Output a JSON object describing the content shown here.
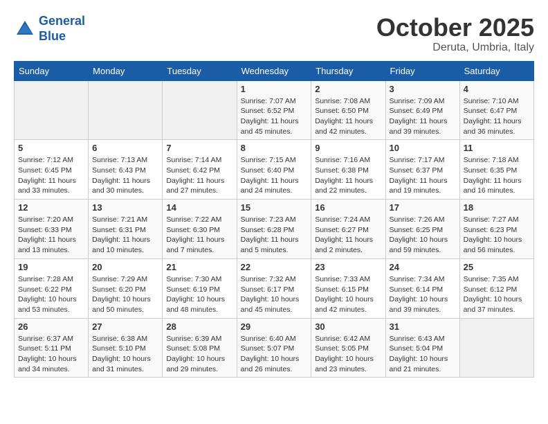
{
  "header": {
    "logo_line1": "General",
    "logo_line2": "Blue",
    "month": "October 2025",
    "location": "Deruta, Umbria, Italy"
  },
  "weekdays": [
    "Sunday",
    "Monday",
    "Tuesday",
    "Wednesday",
    "Thursday",
    "Friday",
    "Saturday"
  ],
  "weeks": [
    [
      {
        "day": "",
        "info": ""
      },
      {
        "day": "",
        "info": ""
      },
      {
        "day": "",
        "info": ""
      },
      {
        "day": "1",
        "info": "Sunrise: 7:07 AM\nSunset: 6:52 PM\nDaylight: 11 hours\nand 45 minutes."
      },
      {
        "day": "2",
        "info": "Sunrise: 7:08 AM\nSunset: 6:50 PM\nDaylight: 11 hours\nand 42 minutes."
      },
      {
        "day": "3",
        "info": "Sunrise: 7:09 AM\nSunset: 6:49 PM\nDaylight: 11 hours\nand 39 minutes."
      },
      {
        "day": "4",
        "info": "Sunrise: 7:10 AM\nSunset: 6:47 PM\nDaylight: 11 hours\nand 36 minutes."
      }
    ],
    [
      {
        "day": "5",
        "info": "Sunrise: 7:12 AM\nSunset: 6:45 PM\nDaylight: 11 hours\nand 33 minutes."
      },
      {
        "day": "6",
        "info": "Sunrise: 7:13 AM\nSunset: 6:43 PM\nDaylight: 11 hours\nand 30 minutes."
      },
      {
        "day": "7",
        "info": "Sunrise: 7:14 AM\nSunset: 6:42 PM\nDaylight: 11 hours\nand 27 minutes."
      },
      {
        "day": "8",
        "info": "Sunrise: 7:15 AM\nSunset: 6:40 PM\nDaylight: 11 hours\nand 24 minutes."
      },
      {
        "day": "9",
        "info": "Sunrise: 7:16 AM\nSunset: 6:38 PM\nDaylight: 11 hours\nand 22 minutes."
      },
      {
        "day": "10",
        "info": "Sunrise: 7:17 AM\nSunset: 6:37 PM\nDaylight: 11 hours\nand 19 minutes."
      },
      {
        "day": "11",
        "info": "Sunrise: 7:18 AM\nSunset: 6:35 PM\nDaylight: 11 hours\nand 16 minutes."
      }
    ],
    [
      {
        "day": "12",
        "info": "Sunrise: 7:20 AM\nSunset: 6:33 PM\nDaylight: 11 hours\nand 13 minutes."
      },
      {
        "day": "13",
        "info": "Sunrise: 7:21 AM\nSunset: 6:31 PM\nDaylight: 11 hours\nand 10 minutes."
      },
      {
        "day": "14",
        "info": "Sunrise: 7:22 AM\nSunset: 6:30 PM\nDaylight: 11 hours\nand 7 minutes."
      },
      {
        "day": "15",
        "info": "Sunrise: 7:23 AM\nSunset: 6:28 PM\nDaylight: 11 hours\nand 5 minutes."
      },
      {
        "day": "16",
        "info": "Sunrise: 7:24 AM\nSunset: 6:27 PM\nDaylight: 11 hours\nand 2 minutes."
      },
      {
        "day": "17",
        "info": "Sunrise: 7:26 AM\nSunset: 6:25 PM\nDaylight: 10 hours\nand 59 minutes."
      },
      {
        "day": "18",
        "info": "Sunrise: 7:27 AM\nSunset: 6:23 PM\nDaylight: 10 hours\nand 56 minutes."
      }
    ],
    [
      {
        "day": "19",
        "info": "Sunrise: 7:28 AM\nSunset: 6:22 PM\nDaylight: 10 hours\nand 53 minutes."
      },
      {
        "day": "20",
        "info": "Sunrise: 7:29 AM\nSunset: 6:20 PM\nDaylight: 10 hours\nand 50 minutes."
      },
      {
        "day": "21",
        "info": "Sunrise: 7:30 AM\nSunset: 6:19 PM\nDaylight: 10 hours\nand 48 minutes."
      },
      {
        "day": "22",
        "info": "Sunrise: 7:32 AM\nSunset: 6:17 PM\nDaylight: 10 hours\nand 45 minutes."
      },
      {
        "day": "23",
        "info": "Sunrise: 7:33 AM\nSunset: 6:15 PM\nDaylight: 10 hours\nand 42 minutes."
      },
      {
        "day": "24",
        "info": "Sunrise: 7:34 AM\nSunset: 6:14 PM\nDaylight: 10 hours\nand 39 minutes."
      },
      {
        "day": "25",
        "info": "Sunrise: 7:35 AM\nSunset: 6:12 PM\nDaylight: 10 hours\nand 37 minutes."
      }
    ],
    [
      {
        "day": "26",
        "info": "Sunrise: 6:37 AM\nSunset: 5:11 PM\nDaylight: 10 hours\nand 34 minutes."
      },
      {
        "day": "27",
        "info": "Sunrise: 6:38 AM\nSunset: 5:10 PM\nDaylight: 10 hours\nand 31 minutes."
      },
      {
        "day": "28",
        "info": "Sunrise: 6:39 AM\nSunset: 5:08 PM\nDaylight: 10 hours\nand 29 minutes."
      },
      {
        "day": "29",
        "info": "Sunrise: 6:40 AM\nSunset: 5:07 PM\nDaylight: 10 hours\nand 26 minutes."
      },
      {
        "day": "30",
        "info": "Sunrise: 6:42 AM\nSunset: 5:05 PM\nDaylight: 10 hours\nand 23 minutes."
      },
      {
        "day": "31",
        "info": "Sunrise: 6:43 AM\nSunset: 5:04 PM\nDaylight: 10 hours\nand 21 minutes."
      },
      {
        "day": "",
        "info": ""
      }
    ]
  ]
}
